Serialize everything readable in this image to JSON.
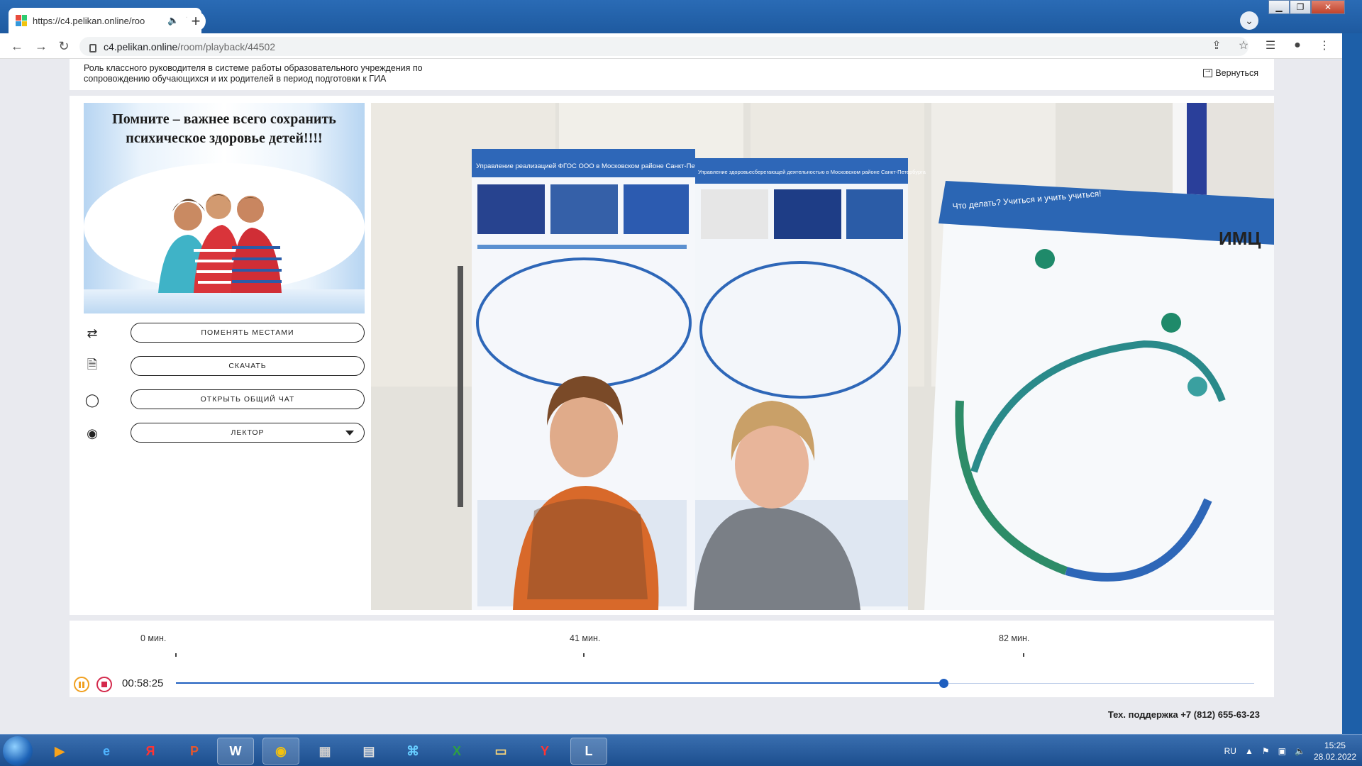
{
  "browser": {
    "tab_title": "https://c4.pelikan.online/roo",
    "url_host": "c4.pelikan.online",
    "url_path": "/room/playback/44502"
  },
  "header": {
    "lesson_title": "Роль классного руководителя в системе работы образовательного учреждения по сопровождению обучающихся и их родителей в период подготовки к ГИА",
    "back_label": "Вернуться"
  },
  "slide": {
    "text": "Помните – важнее всего сохранить психическое здоровье детей!!!!"
  },
  "controls": [
    {
      "icon": "swap-icon",
      "label": "ПОМЕНЯТЬ МЕСТАМИ"
    },
    {
      "icon": "document-icon",
      "label": "СКАЧАТЬ"
    },
    {
      "icon": "chat-bubble-icon",
      "label": "ОТКРЫТЬ ОБЩИЙ ЧАТ"
    },
    {
      "icon": "webcam-icon",
      "label": "ЛЕКТОР"
    }
  ],
  "timeline": {
    "ticks": [
      "0 мин.",
      "41 мин.",
      "82 мин."
    ],
    "current_time": "00:58:25",
    "progress_fraction": 0.712
  },
  "video": {
    "poster_left_title": "Управление реализацией ФГОС ООО в Московском районе Санкт-Петербурга",
    "poster_mid_title": "Управление здоровьесберегающей деятельностью в Московском районе Санкт-Петербурга",
    "poster_right_title": "Что делать? Учиться и учить учиться!",
    "poster_right_logo": "ИМЦ"
  },
  "footer": {
    "support": "Тех. поддержка +7 (812) 655-63-23"
  },
  "taskbar": {
    "lang": "RU",
    "time": "15:25",
    "date": "28.02.2022"
  }
}
